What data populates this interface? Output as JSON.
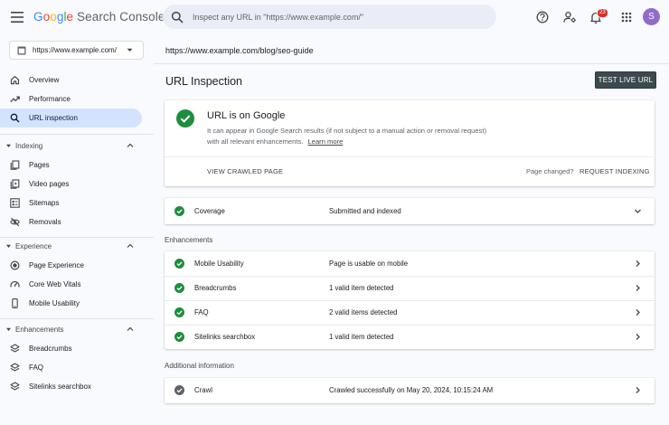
{
  "app": {
    "logo_google": [
      "G",
      "o",
      "o",
      "g",
      "l",
      "e"
    ],
    "logo_product": "Search Console"
  },
  "search": {
    "placeholder": "Inspect any URL in \"https://www.example.com/\""
  },
  "notifications": {
    "count": "23"
  },
  "user": {
    "avatar_letter": "S"
  },
  "property": {
    "selected": "https://www.example.com/"
  },
  "sidebar": {
    "top_items": [
      {
        "label": "Overview",
        "icon": "home-icon"
      },
      {
        "label": "Performance",
        "icon": "trending-icon"
      },
      {
        "label": "URL inspection",
        "icon": "search-icon",
        "active": true
      }
    ],
    "sections": [
      {
        "title": "Indexing",
        "items": [
          {
            "label": "Pages",
            "icon": "pages-icon"
          },
          {
            "label": "Video pages",
            "icon": "video-icon"
          },
          {
            "label": "Sitemaps",
            "icon": "sitemap-icon"
          },
          {
            "label": "Removals",
            "icon": "removals-icon"
          }
        ]
      },
      {
        "title": "Experience",
        "items": [
          {
            "label": "Page Experience",
            "icon": "page-experience-icon"
          },
          {
            "label": "Core Web Vitals",
            "icon": "speed-icon"
          },
          {
            "label": "Mobile Usability",
            "icon": "phone-icon"
          }
        ]
      },
      {
        "title": "Enhancements",
        "items": [
          {
            "label": "Breadcrumbs",
            "icon": "layers-icon"
          },
          {
            "label": "FAQ",
            "icon": "layers-icon"
          },
          {
            "label": "Sitelinks searchbox",
            "icon": "layers-icon"
          }
        ]
      }
    ]
  },
  "main": {
    "inspected_url": "https://www.example.com/blog/seo-guide",
    "title": "URL Inspection",
    "test_live_label": "TEST LIVE URL",
    "status": {
      "title": "URL is on Google",
      "description": "It can appear in Google Search results (if not subject to a manual action or removal request) with all relevant enhancements.",
      "learn_more": "Learn more",
      "view_crawled": "VIEW CRAWLED PAGE",
      "page_changed": "Page changed?",
      "request_indexing": "REQUEST INDEXING"
    },
    "coverage": {
      "label": "Coverage",
      "value": "Submitted and indexed"
    },
    "enhancements_title": "Enhancements",
    "enhancements": [
      {
        "label": "Mobile Usability",
        "value": "Page is usable on mobile"
      },
      {
        "label": "Breadcrumbs",
        "value": "1 valid item detected"
      },
      {
        "label": "FAQ",
        "value": "2 valid items detected"
      },
      {
        "label": "Sitelinks searchbox",
        "value": "1 valid item detected"
      }
    ],
    "additional_title": "Additional information",
    "crawl": {
      "label": "Crawl",
      "value": "Crawled successfully on May 20, 2024, 10:15:24 AM"
    }
  },
  "colors": {
    "success_green": "#1e8e3e",
    "active_nav": "#d3e3fd",
    "primary_button": "#3c4a4f"
  }
}
